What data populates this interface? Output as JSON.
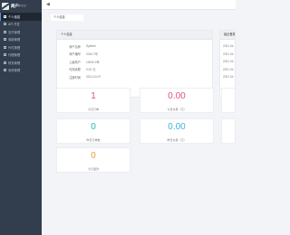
{
  "app": {
    "logo_text": "商户",
    "logo_suffix": "PAY"
  },
  "sidebar": {
    "items": [
      {
        "label": "个人信息",
        "active": true
      },
      {
        "label": "API 开发"
      },
      {
        "label": "支付管理"
      },
      {
        "label": "收款管理"
      },
      {
        "label": "代付管理"
      },
      {
        "label": "代理管理"
      },
      {
        "label": "财务管理"
      },
      {
        "label": "系统管理"
      }
    ]
  },
  "tabs": [
    {
      "label": "个人信息"
    }
  ],
  "profile": {
    "title": "个人信息",
    "rows": [
      {
        "key": "商户名称",
        "value": "Systest"
      },
      {
        "key": "商户编号",
        "value": "2040 1号"
      },
      {
        "key": "上级商户",
        "value": "10000 4号"
      },
      {
        "key": "可用余额",
        "value": "0.00 元"
      },
      {
        "key": "注册时间",
        "value": "2021-04-07"
      }
    ]
  },
  "side_panel": {
    "title": "最近登录",
    "items": [
      "2021 04",
      "2021 04",
      "2021 04",
      "2021 04",
      "2021 04"
    ]
  },
  "stats": [
    {
      "value": "1",
      "label": "今日订单",
      "color": "#e0527f"
    },
    {
      "value": "0.00",
      "label": "今日交易（元）",
      "color": "#e0527f"
    },
    {
      "value": "0",
      "label": "昨日订单数",
      "color": "#2bb9a8"
    },
    {
      "value": "0.00",
      "label": "昨日交易（元）",
      "color": "#3cb6d8"
    },
    {
      "value": "0",
      "label": "今日退款",
      "color": "#e6a23c"
    }
  ],
  "colors": {
    "sidebar_bg": "#323d4d",
    "page_bg": "#f2f4f7"
  }
}
